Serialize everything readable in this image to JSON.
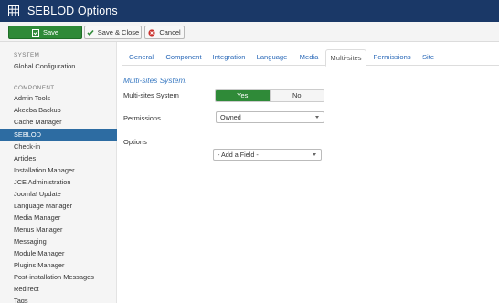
{
  "header": {
    "title": "SEBLOD Options",
    "icon": "grid-app-icon"
  },
  "toolbar": {
    "save_label": "Save",
    "save_close_label": "Save & Close",
    "cancel_label": "Cancel"
  },
  "sidebar": {
    "system_header": "SYSTEM",
    "system_items": [
      {
        "label": "Global Configuration"
      }
    ],
    "component_header": "COMPONENT",
    "items": [
      {
        "label": "Admin Tools"
      },
      {
        "label": "Akeeba Backup"
      },
      {
        "label": "Cache Manager"
      },
      {
        "label": "SEBLOD",
        "active": true
      },
      {
        "label": "Check-in"
      },
      {
        "label": "Articles"
      },
      {
        "label": "Installation Manager"
      },
      {
        "label": "JCE Administration"
      },
      {
        "label": "Joomla! Update"
      },
      {
        "label": "Language Manager"
      },
      {
        "label": "Media Manager"
      },
      {
        "label": "Menus Manager"
      },
      {
        "label": "Messaging"
      },
      {
        "label": "Module Manager"
      },
      {
        "label": "Plugins Manager"
      },
      {
        "label": "Post-installation Messages"
      },
      {
        "label": "Redirect"
      },
      {
        "label": "Tags"
      }
    ]
  },
  "tabs": [
    {
      "label": "General"
    },
    {
      "label": "Component"
    },
    {
      "label": "Integration"
    },
    {
      "label": "Language"
    },
    {
      "label": "Media"
    },
    {
      "label": "Multi-sites",
      "active": true
    },
    {
      "label": "Permissions"
    },
    {
      "label": "Site"
    }
  ],
  "main": {
    "section_title": "Multi-sites System.",
    "multisites_label": "Multi-sites System",
    "toggle_yes": "Yes",
    "toggle_no": "No",
    "toggle_selected": "Yes",
    "permissions_label": "Permissions",
    "permissions_value": "Owned",
    "options_label": "Options",
    "add_field_value": "- Add a Field -"
  },
  "colors": {
    "header_bg": "#1a3867",
    "save_green": "#2f8a38",
    "active_blue": "#2d6ca2",
    "link_blue": "#2a69b8"
  }
}
